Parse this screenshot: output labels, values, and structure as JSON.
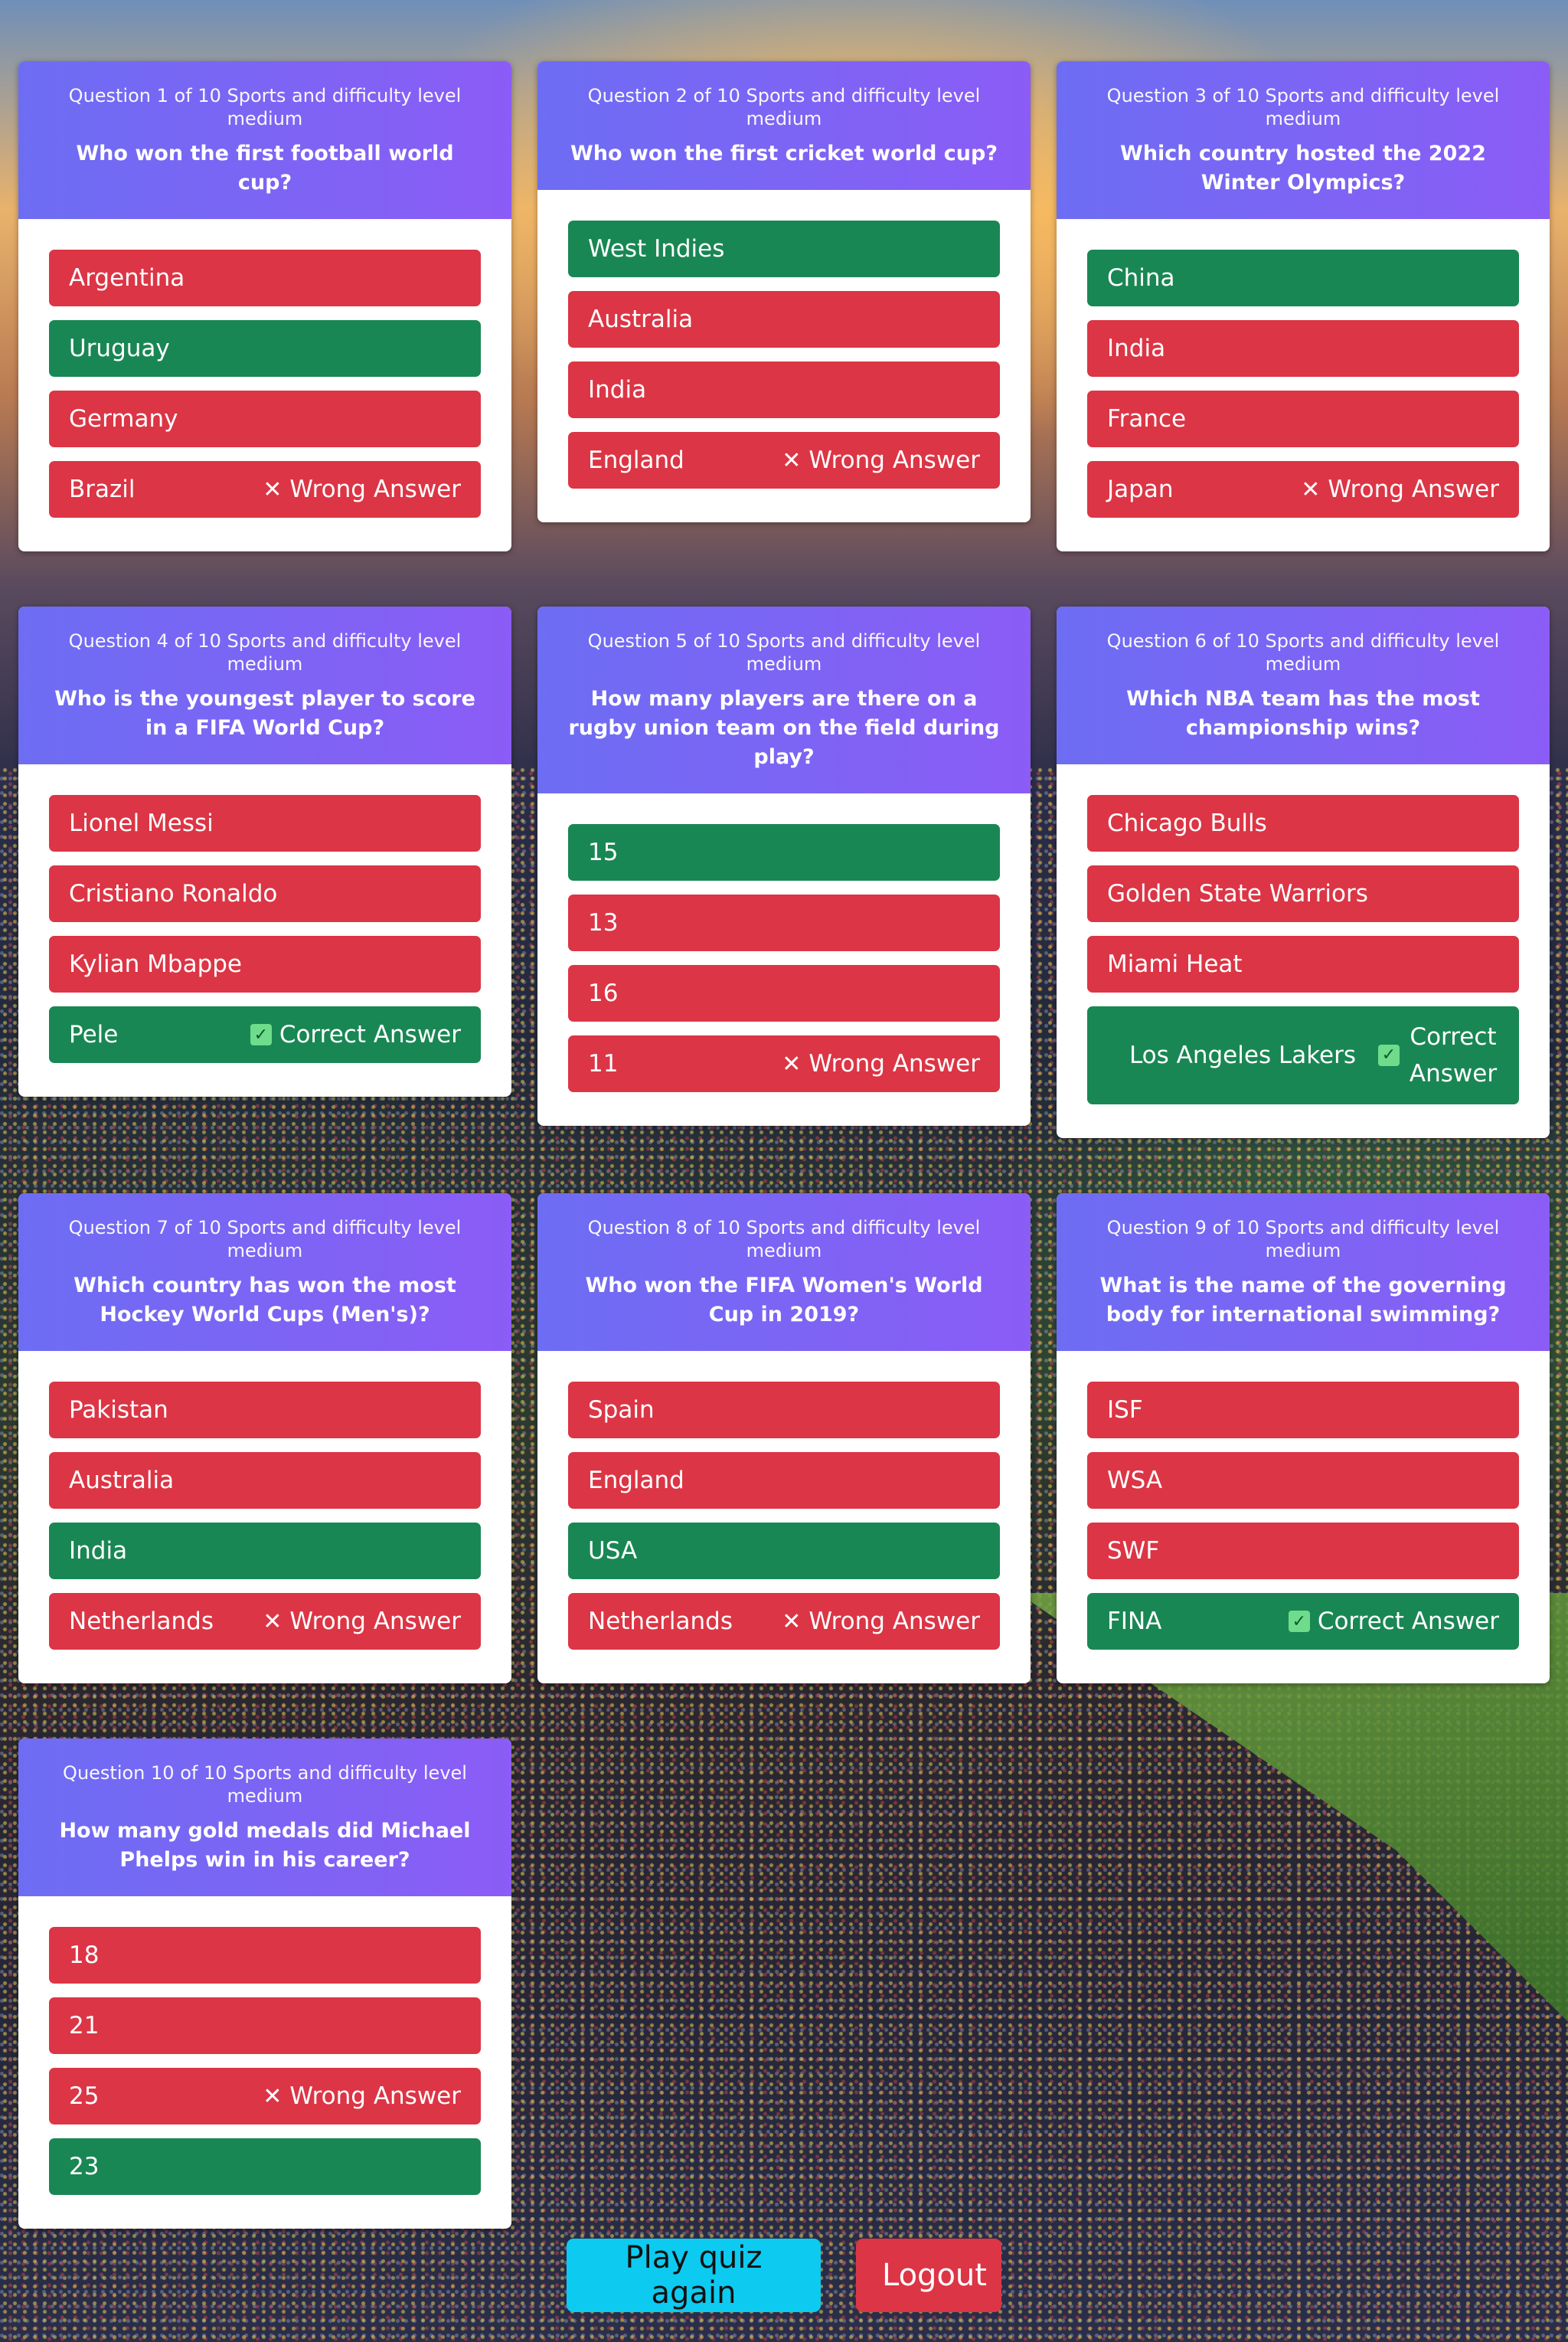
{
  "questions": [
    {
      "meta": "Question 1 of 10 Sports and difficulty level medium",
      "text": "Who won the first football world cup?",
      "answers": [
        {
          "label": "Argentina",
          "color": "red"
        },
        {
          "label": "Uruguay",
          "color": "green"
        },
        {
          "label": "Germany",
          "color": "red"
        },
        {
          "label": "Brazil",
          "color": "red",
          "result": "Wrong Answer"
        }
      ]
    },
    {
      "meta": "Question 2 of 10 Sports and difficulty level medium",
      "text": "Who won the first cricket world cup?",
      "answers": [
        {
          "label": "West Indies",
          "color": "green"
        },
        {
          "label": "Australia",
          "color": "red"
        },
        {
          "label": "India",
          "color": "red"
        },
        {
          "label": "England",
          "color": "red",
          "result": "Wrong Answer"
        }
      ]
    },
    {
      "meta": "Question 3 of 10 Sports and difficulty level medium",
      "text": "Which country hosted the 2022 Winter Olympics?",
      "answers": [
        {
          "label": "China",
          "color": "green"
        },
        {
          "label": "India",
          "color": "red"
        },
        {
          "label": "France",
          "color": "red"
        },
        {
          "label": "Japan",
          "color": "red",
          "result": "Wrong Answer"
        }
      ]
    },
    {
      "meta": "Question 4 of 10 Sports and difficulty level medium",
      "text": "Who is the youngest player to score in a FIFA World Cup?",
      "answers": [
        {
          "label": "Lionel Messi",
          "color": "red"
        },
        {
          "label": "Cristiano Ronaldo",
          "color": "red"
        },
        {
          "label": "Kylian Mbappe",
          "color": "red"
        },
        {
          "label": "Pele",
          "color": "green",
          "result": "Correct Answer"
        }
      ]
    },
    {
      "meta": "Question 5 of 10 Sports and difficulty level medium",
      "text": "How many players are there on a rugby union team on the field during play?",
      "answers": [
        {
          "label": "15",
          "color": "green"
        },
        {
          "label": "13",
          "color": "red"
        },
        {
          "label": "16",
          "color": "red"
        },
        {
          "label": "11",
          "color": "red",
          "result": "Wrong Answer"
        }
      ]
    },
    {
      "meta": "Question 6 of 10 Sports and difficulty level medium",
      "text": "Which NBA team has the most championship wins?",
      "answers": [
        {
          "label": "Chicago Bulls",
          "color": "red"
        },
        {
          "label": "Golden State Warriors",
          "color": "red"
        },
        {
          "label": "Miami Heat",
          "color": "red"
        },
        {
          "label": "Los Angeles Lakers",
          "color": "green",
          "result": "Correct Answer"
        }
      ]
    },
    {
      "meta": "Question 7 of 10 Sports and difficulty level medium",
      "text": "Which country has won the most Hockey World Cups (Men's)?",
      "answers": [
        {
          "label": "Pakistan",
          "color": "red"
        },
        {
          "label": "Australia",
          "color": "red"
        },
        {
          "label": "India",
          "color": "green"
        },
        {
          "label": "Netherlands",
          "color": "red",
          "result": "Wrong Answer"
        }
      ]
    },
    {
      "meta": "Question 8 of 10 Sports and difficulty level medium",
      "text": "Who won the FIFA Women's World Cup in 2019?",
      "answers": [
        {
          "label": "Spain",
          "color": "red"
        },
        {
          "label": "England",
          "color": "red"
        },
        {
          "label": "USA",
          "color": "green"
        },
        {
          "label": "Netherlands",
          "color": "red",
          "result": "Wrong Answer"
        }
      ]
    },
    {
      "meta": "Question 9 of 10 Sports and difficulty level medium",
      "text": "What is the name of the governing body for international swimming?",
      "answers": [
        {
          "label": "ISF",
          "color": "red"
        },
        {
          "label": "WSA",
          "color": "red"
        },
        {
          "label": "SWF",
          "color": "red"
        },
        {
          "label": "FINA",
          "color": "green",
          "result": "Correct Answer"
        }
      ]
    },
    {
      "meta": "Question 10 of 10 Sports and difficulty level medium",
      "text": "How many gold medals did Michael Phelps win in his career?",
      "answers": [
        {
          "label": "18",
          "color": "red"
        },
        {
          "label": "21",
          "color": "red"
        },
        {
          "label": "25",
          "color": "red",
          "result": "Wrong Answer"
        },
        {
          "label": "23",
          "color": "green"
        }
      ]
    }
  ],
  "icons": {
    "wrong": "x-icon",
    "correct": "check-icon"
  },
  "colors": {
    "red": "#dc3545",
    "green": "#198754",
    "header": "#7c67f5",
    "cyan": "#0dcaf0"
  },
  "buttons": {
    "play_again": "Play quiz again",
    "logout": "Logout"
  }
}
